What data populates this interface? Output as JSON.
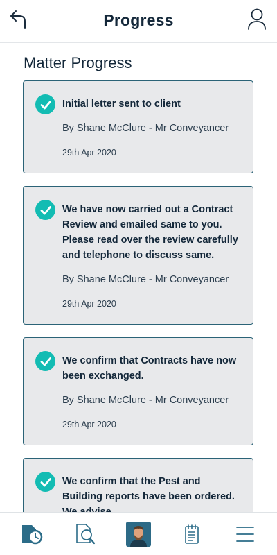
{
  "header": {
    "title": "Progress",
    "back_icon": "back-arrow-icon",
    "profile_icon": "user-icon"
  },
  "main": {
    "section_title": "Matter Progress",
    "items": [
      {
        "message": "Initial letter sent to client",
        "author": "By Shane McClure - Mr Conveyancer",
        "date": "29th Apr 2020",
        "status_icon": "check-circle-icon"
      },
      {
        "message": "We have now carried out a Contract Review and emailed same to you. Please read over the review carefully and telephone to discuss same.",
        "author": "By Shane McClure - Mr Conveyancer",
        "date": "29th Apr 2020",
        "status_icon": "check-circle-icon"
      },
      {
        "message": "We confirm that Contracts have now been exchanged.",
        "author": "By Shane McClure - Mr Conveyancer",
        "date": "29th Apr 2020",
        "status_icon": "check-circle-icon"
      },
      {
        "message": "We confirm that the Pest and Building reports have been ordered. We advise",
        "author": "",
        "date": "",
        "status_icon": "check-circle-icon"
      }
    ]
  },
  "bottom_nav": {
    "items": [
      {
        "icon": "document-clock-icon",
        "active": true
      },
      {
        "icon": "document-search-icon",
        "active": false
      },
      {
        "icon": "avatar",
        "active": false
      },
      {
        "icon": "notepad-icon",
        "active": false
      },
      {
        "icon": "menu-icon",
        "active": false
      }
    ]
  },
  "colors": {
    "accent": "#13bcb3",
    "card_border": "#2b6377",
    "card_bg": "#e8e9eb",
    "nav_icon": "#2b6c88"
  }
}
